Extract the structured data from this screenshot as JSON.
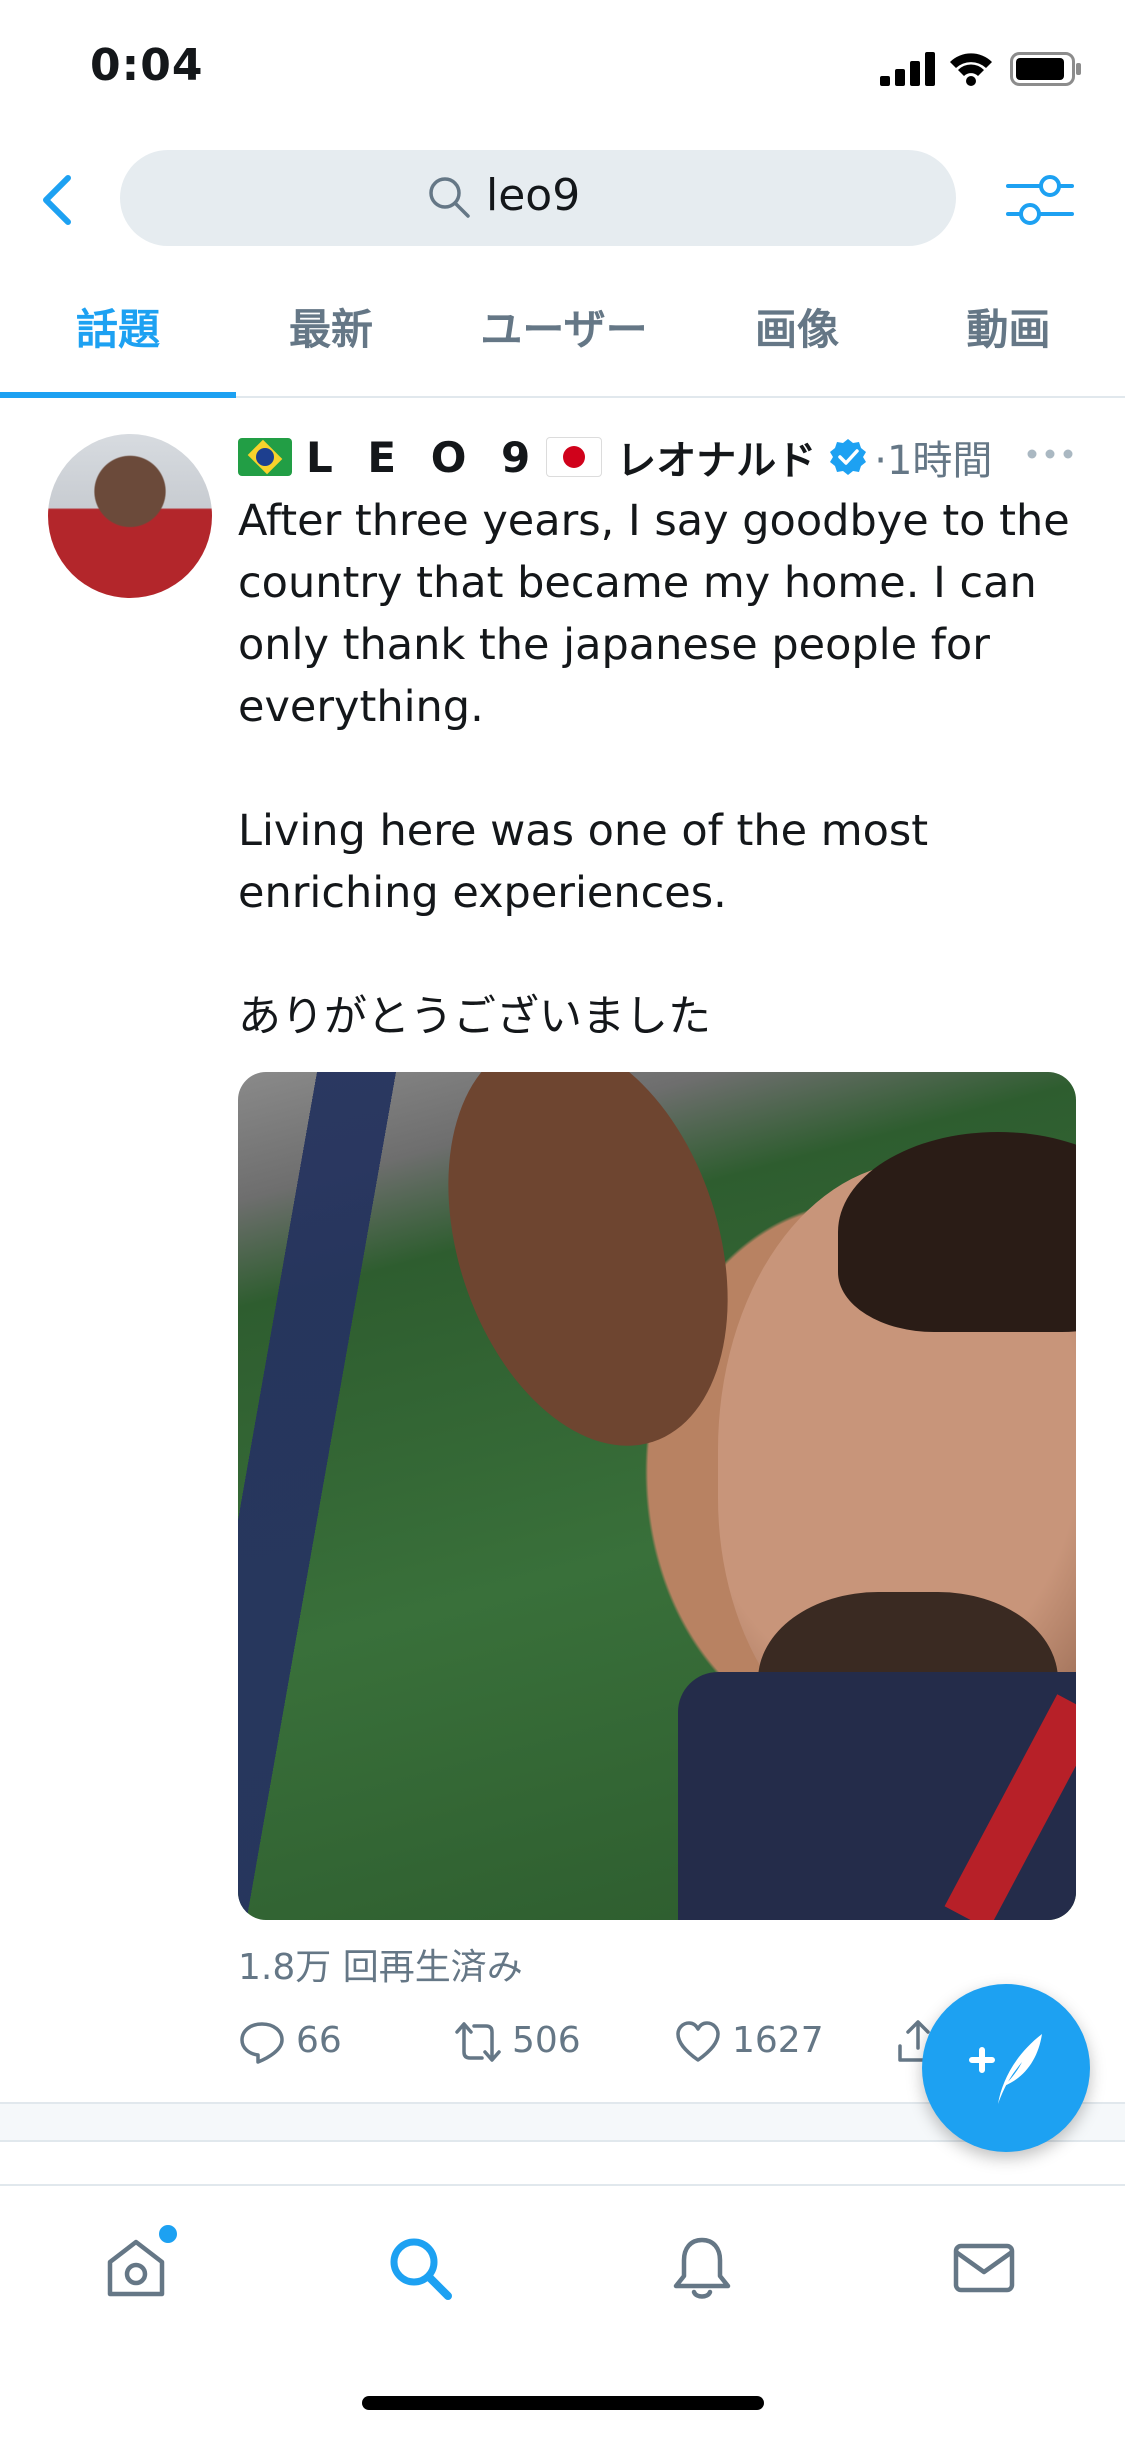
{
  "status_bar": {
    "time": "0:04"
  },
  "search": {
    "query": "leo9"
  },
  "tabs": [
    {
      "label": "話題",
      "active": true
    },
    {
      "label": "最新",
      "active": false
    },
    {
      "label": "ユーザー",
      "active": false
    },
    {
      "label": "画像",
      "active": false
    },
    {
      "label": "動画",
      "active": false
    }
  ],
  "tweet": {
    "name_part1": "L E O 9",
    "name_part2": "レオナルド",
    "verified": true,
    "timestamp": "·1時間",
    "paragraphs": [
      "After three years, I say goodbye to the country that became my home. I can only thank the japanese people for everything.",
      "Living here was one of the most enriching experiences.",
      "ありがとうございました"
    ],
    "view_count": "1.8万 回再生済み",
    "replies": "66",
    "retweets": "506",
    "likes": "1627"
  },
  "colors": {
    "accent": "#1da1f2",
    "muted": "#657786",
    "text": "#14171a"
  },
  "icons": {
    "back": "chevron-left-icon",
    "search": "search-icon",
    "filter": "filter-sliders-icon",
    "more": "more-dots-icon",
    "reply": "reply-bubble-icon",
    "retweet": "retweet-icon",
    "like": "heart-icon",
    "share": "share-icon",
    "compose": "compose-feather-icon",
    "nav": [
      "home-icon",
      "search-icon",
      "notifications-bell-icon",
      "messages-envelope-icon"
    ]
  }
}
